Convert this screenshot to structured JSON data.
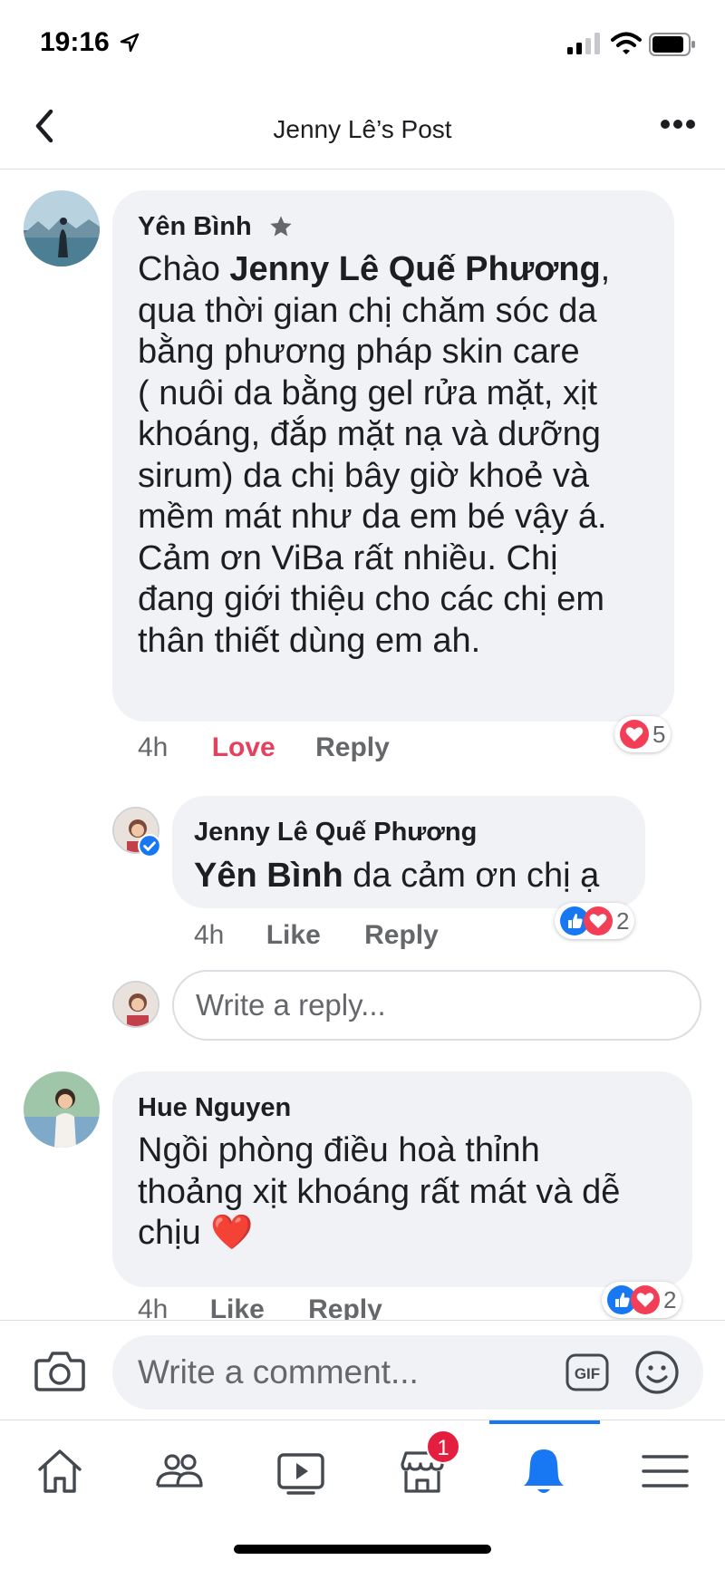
{
  "status": {
    "time": "19:16"
  },
  "nav": {
    "title": "Jenny Lê’s Post"
  },
  "comments": [
    {
      "author": "Yên Bình",
      "text_lines": [
        [
          "Chào ",
          "Jenny Lê Quế Phương",
          ","
        ],
        "qua thời gian chị chăm sóc da",
        "bằng phương pháp skin care",
        "( nuôi da bằng gel rửa mặt, xịt",
        "khoáng, đắp mặt nạ và dưỡng",
        "sirum) da chị bây giờ khoẻ và",
        "mềm mát như da em bé vậy á.",
        "Cảm ơn ViBa rất nhiều. Chị",
        "đang giới thiệu cho các chị em",
        "thân thiết dùng em ah."
      ],
      "time": "4h",
      "action": "Love",
      "reply": "Reply",
      "reaction_count": "5"
    },
    {
      "author": "Jenny Lê Quế Phương",
      "mention": "Yên Bình",
      "text": " da cảm ơn chị ạ",
      "time": "4h",
      "action": "Like",
      "reply": "Reply",
      "reaction_count": "2"
    },
    {
      "author": "Hue Nguyen",
      "text_lines": [
        "Ngồi phòng điều hoà thỉnh",
        "thoảng xịt khoáng rất mát và dễ",
        "chịu ❤️"
      ],
      "time": "4h",
      "action": "Like",
      "reply": "Reply",
      "reaction_count": "2"
    }
  ],
  "reply_input": {
    "placeholder": "Write a reply..."
  },
  "composer": {
    "placeholder": "Write a comment...",
    "gif_label": "GIF"
  },
  "tabs": {
    "items": [
      "home-icon",
      "friends-icon",
      "watch-icon",
      "marketplace-icon",
      "notifications-icon",
      "menu-icon"
    ],
    "active": "notifications-icon",
    "marketplace_badge": "1"
  },
  "colors": {
    "love": "#e4405f",
    "like_blue": "#1877f2",
    "bubble": "#f0f2f5",
    "heart_red": "#f33e58"
  }
}
